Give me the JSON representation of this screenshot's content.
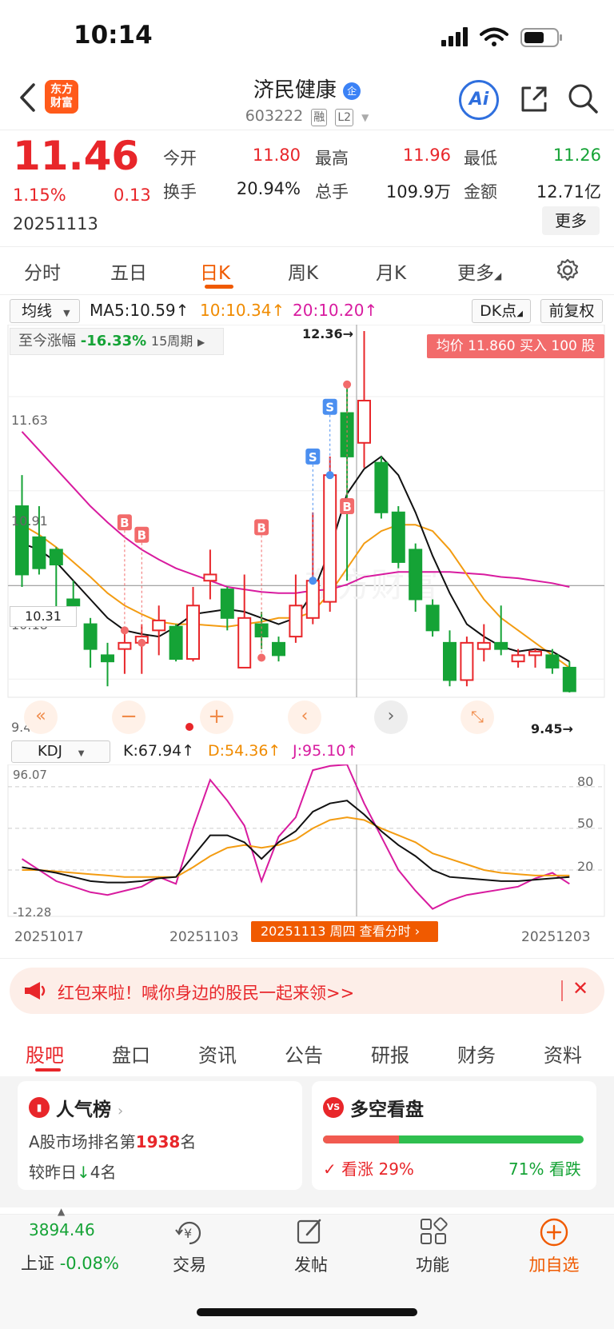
{
  "status_bar": {
    "time": "10:14"
  },
  "header": {
    "logo_line1": "东方",
    "logo_line2": "财富",
    "title": "济民健康",
    "title_badge": "企",
    "code": "603222",
    "tag_rong": "融",
    "tag_l2": "L2",
    "ai_label": "Ai"
  },
  "quote": {
    "price": "11.46",
    "change_pct": "1.15%",
    "change": "0.13",
    "date": "20251113",
    "open_label": "今开",
    "open": "11.80",
    "high_label": "最高",
    "high": "11.96",
    "low_label": "最低",
    "low": "11.26",
    "turnover_label": "换手",
    "turnover": "20.94%",
    "volume_label": "总手",
    "volume": "109.9万",
    "amount_label": "金额",
    "amount": "12.71亿",
    "more_label": "更多"
  },
  "tabs": [
    "分时",
    "五日",
    "日K",
    "周K",
    "月K",
    "更多"
  ],
  "ma_bar": {
    "select": "均线",
    "ma5": "MA5:10.59↑",
    "ma10": "10:10.34↑",
    "ma20": "20:10.20↑",
    "dk": "DK点",
    "adjust": "前复权"
  },
  "kchart": {
    "period_label": "至今涨幅",
    "period_value": "-16.33%",
    "period_count": "15周期",
    "avg_tip": "均价 11.860 买入 100 股",
    "y_labels": [
      "11.63",
      "10.91",
      "10.18",
      "9.45"
    ],
    "crosshair_value": "10.31",
    "max_label": "12.36",
    "min_label": "9.45",
    "watermark": "东方财富",
    "markers": [
      "B",
      "B",
      "B",
      "S",
      "S",
      "B"
    ]
  },
  "kdj_bar": {
    "select": "KDJ",
    "k": "K:67.94↑",
    "d": "D:54.36↑",
    "j": "J:95.10↑"
  },
  "kdj": {
    "y_top": "96.07",
    "y_bottom": "-12.28",
    "levels": [
      "80",
      "50",
      "20"
    ]
  },
  "chart_data": {
    "type": "candlestick",
    "dates_shown": [
      "20251017",
      "20251103",
      "20251203"
    ],
    "cursor_label": "20251113 周四 查看分时",
    "ylim": [
      9.45,
      12.36
    ],
    "candles": [
      {
        "o": 10.95,
        "c": 10.4,
        "h": 11.2,
        "l": 10.3
      },
      {
        "o": 10.7,
        "c": 10.45,
        "h": 10.95,
        "l": 10.4
      },
      {
        "o": 10.6,
        "c": 10.48,
        "h": 10.62,
        "l": 10.05
      },
      {
        "o": 10.2,
        "c": 10.15,
        "h": 10.35,
        "l": 10.05
      },
      {
        "o": 10.0,
        "c": 9.8,
        "h": 10.05,
        "l": 9.65
      },
      {
        "o": 9.75,
        "c": 9.7,
        "h": 9.85,
        "l": 9.5
      },
      {
        "o": 9.8,
        "c": 9.85,
        "h": 9.95,
        "l": 9.6
      },
      {
        "o": 9.85,
        "c": 9.9,
        "h": 10.0,
        "l": 9.6
      },
      {
        "o": 9.95,
        "c": 10.03,
        "h": 10.15,
        "l": 9.75
      },
      {
        "o": 9.98,
        "c": 9.72,
        "h": 10.0,
        "l": 9.7
      },
      {
        "o": 9.72,
        "c": 10.15,
        "h": 10.3,
        "l": 9.7
      },
      {
        "o": 10.35,
        "c": 10.4,
        "h": 10.6,
        "l": 10.2
      },
      {
        "o": 10.28,
        "c": 10.05,
        "h": 10.3,
        "l": 9.95
      },
      {
        "o": 9.65,
        "c": 10.05,
        "h": 10.4,
        "l": 9.65
      },
      {
        "o": 10.0,
        "c": 9.9,
        "h": 10.1,
        "l": 9.8
      },
      {
        "o": 9.85,
        "c": 9.75,
        "h": 9.9,
        "l": 9.7
      },
      {
        "o": 9.9,
        "c": 10.15,
        "h": 10.4,
        "l": 9.85
      },
      {
        "o": 10.05,
        "c": 10.35,
        "h": 10.9,
        "l": 10.0
      },
      {
        "o": 10.18,
        "c": 11.2,
        "h": 11.35,
        "l": 10.1
      },
      {
        "o": 11.7,
        "c": 11.35,
        "h": 11.95,
        "l": 10.35
      },
      {
        "o": 11.46,
        "c": 11.8,
        "h": 12.36,
        "l": 11.26
      },
      {
        "o": 11.3,
        "c": 10.9,
        "h": 11.35,
        "l": 10.85
      },
      {
        "o": 10.9,
        "c": 10.5,
        "h": 10.95,
        "l": 10.45
      },
      {
        "o": 10.6,
        "c": 10.2,
        "h": 10.65,
        "l": 10.1
      },
      {
        "o": 10.15,
        "c": 9.95,
        "h": 10.2,
        "l": 9.9
      },
      {
        "o": 9.85,
        "c": 9.55,
        "h": 9.95,
        "l": 9.5
      },
      {
        "o": 9.55,
        "c": 9.85,
        "h": 9.9,
        "l": 9.5
      },
      {
        "o": 9.8,
        "c": 9.85,
        "h": 10.0,
        "l": 9.7
      },
      {
        "o": 9.85,
        "c": 9.8,
        "h": 10.15,
        "l": 9.75
      },
      {
        "o": 9.7,
        "c": 9.75,
        "h": 9.8,
        "l": 9.65
      },
      {
        "o": 9.75,
        "c": 9.78,
        "h": 9.8,
        "l": 9.65
      },
      {
        "o": 9.75,
        "c": 9.65,
        "h": 9.8,
        "l": 9.6
      },
      {
        "o": 9.65,
        "c": 9.46,
        "h": 9.7,
        "l": 9.45
      }
    ],
    "ma5": [
      10.65,
      10.6,
      10.5,
      10.35,
      10.2,
      10.05,
      9.95,
      9.92,
      9.9,
      9.98,
      10.08,
      10.1,
      10.12,
      10.1,
      10.05,
      10.0,
      10.05,
      10.25,
      10.6,
      11.05,
      11.25,
      11.35,
      11.2,
      10.9,
      10.55,
      10.25,
      10.0,
      9.9,
      9.82,
      9.78,
      9.8,
      9.78,
      9.7
    ],
    "ma10": [
      10.8,
      10.72,
      10.62,
      10.5,
      10.38,
      10.25,
      10.15,
      10.08,
      10.02,
      10.0,
      10.0,
      9.99,
      9.98,
      10.0,
      10.02,
      10.05,
      10.05,
      10.1,
      10.25,
      10.45,
      10.65,
      10.75,
      10.8,
      10.8,
      10.75,
      10.6,
      10.4,
      10.2,
      10.05,
      9.95,
      9.85,
      9.75,
      9.65
    ],
    "ma20": [
      11.55,
      11.4,
      11.25,
      11.1,
      10.95,
      10.82,
      10.7,
      10.6,
      10.52,
      10.45,
      10.4,
      10.35,
      10.3,
      10.28,
      10.26,
      10.25,
      10.25,
      10.27,
      10.28,
      10.32,
      10.38,
      10.4,
      10.42,
      10.42,
      10.42,
      10.42,
      10.41,
      10.4,
      10.38,
      10.37,
      10.35,
      10.33,
      10.3
    ],
    "kdj_k": [
      22,
      20,
      18,
      15,
      12,
      11,
      11,
      12,
      14,
      15,
      30,
      45,
      45,
      40,
      28,
      40,
      48,
      62,
      68,
      70,
      60,
      48,
      38,
      30,
      20,
      15,
      14,
      13,
      12,
      12,
      13,
      14,
      15
    ],
    "kdj_d": [
      20,
      20,
      19,
      18,
      17,
      16,
      15,
      15,
      15,
      15,
      22,
      30,
      36,
      38,
      36,
      38,
      42,
      50,
      56,
      58,
      56,
      50,
      45,
      40,
      32,
      28,
      24,
      20,
      18,
      17,
      16,
      16,
      16
    ],
    "kdj_j": [
      28,
      20,
      12,
      8,
      4,
      2,
      5,
      8,
      15,
      10,
      50,
      85,
      70,
      52,
      12,
      44,
      58,
      92,
      95,
      96,
      68,
      44,
      20,
      5,
      -8,
      -2,
      2,
      4,
      6,
      8,
      14,
      18,
      10
    ]
  },
  "banner": {
    "text": "红包来啦！喊你身边的股民一起来领>>"
  },
  "bottom_tabs": [
    "股吧",
    "盘口",
    "资讯",
    "公告",
    "研报",
    "财务",
    "资料"
  ],
  "cards": {
    "popularity_title": "人气榜",
    "popularity_line1_prefix": "A股市场排名第",
    "popularity_rank": "1938",
    "popularity_line1_suffix": "名",
    "popularity_line2_prefix": "较昨日",
    "popularity_change": "4名",
    "sentiment_title": "多空看盘",
    "bull_label": "看涨",
    "bull_pct": "29%",
    "bear_pct": "71%",
    "bear_label": "看跌",
    "bull_value": 0.29
  },
  "nav": {
    "index_value": "3894.46",
    "index_name": "上证",
    "index_change": "-0.08%",
    "trade": "交易",
    "post": "发帖",
    "features": "功能",
    "add_watch": "加自选"
  },
  "colors": {
    "up": "#e8262a",
    "down": "#15a336",
    "ma5": "#111111",
    "ma10": "#f39c12",
    "ma20": "#d81b9f",
    "accent": "#f05a00"
  }
}
